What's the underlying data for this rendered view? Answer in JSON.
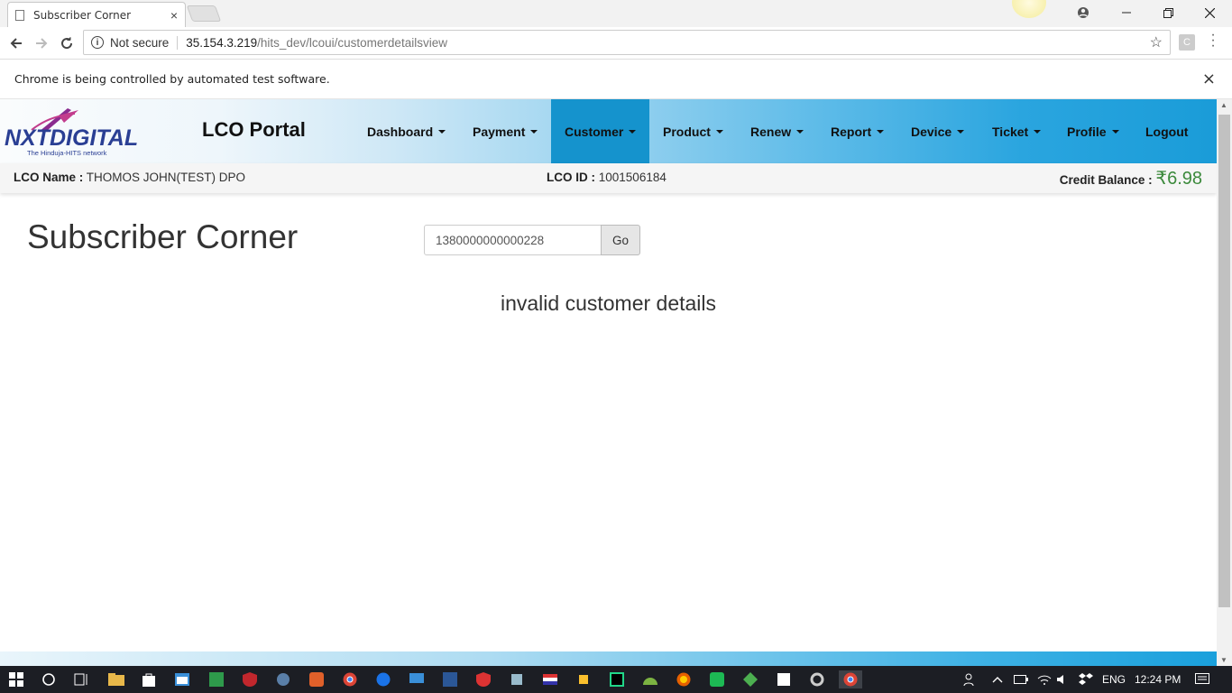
{
  "browser": {
    "tab_title": "Subscriber Corner",
    "tab_close": "×",
    "not_secure": "Not secure",
    "url_host": "35.154.3.219",
    "url_path": "/hits_dev/lcoui/customerdetailsview",
    "ext_label": "C",
    "infobar_text": "Chrome is being controlled by automated test software.",
    "infobar_close": "×"
  },
  "logo": {
    "text": "NXTDIGITAL",
    "tagline": "The Hinduja-HITS network"
  },
  "navbar": {
    "brand": "LCO Portal",
    "items": [
      {
        "label": "Dashboard",
        "dropdown": true
      },
      {
        "label": "Payment",
        "dropdown": true
      },
      {
        "label": "Customer",
        "dropdown": true,
        "active": true
      },
      {
        "label": "Product",
        "dropdown": true
      },
      {
        "label": "Renew",
        "dropdown": true
      },
      {
        "label": "Report",
        "dropdown": true
      },
      {
        "label": "Device",
        "dropdown": true
      },
      {
        "label": "Ticket",
        "dropdown": true
      },
      {
        "label": "Profile",
        "dropdown": true
      },
      {
        "label": "Logout",
        "dropdown": false
      }
    ]
  },
  "info": {
    "lco_name_label": "LCO Name :",
    "lco_name": "THOMOS JOHN(TEST) DPO",
    "lco_id_label": "LCO ID :",
    "lco_id": "1001506184",
    "credit_label": "Credit Balance :",
    "credit_value": "₹6.98"
  },
  "main": {
    "title": "Subscriber Corner",
    "search_value": "1380000000000228",
    "go_label": "Go",
    "message": "invalid customer details"
  },
  "taskbar": {
    "language": "ENG",
    "time": "12:24 PM"
  },
  "colors": {
    "nav_active": "#1593cd",
    "credit": "#3c8a3c",
    "brand_blue": "#1a9cd8"
  }
}
